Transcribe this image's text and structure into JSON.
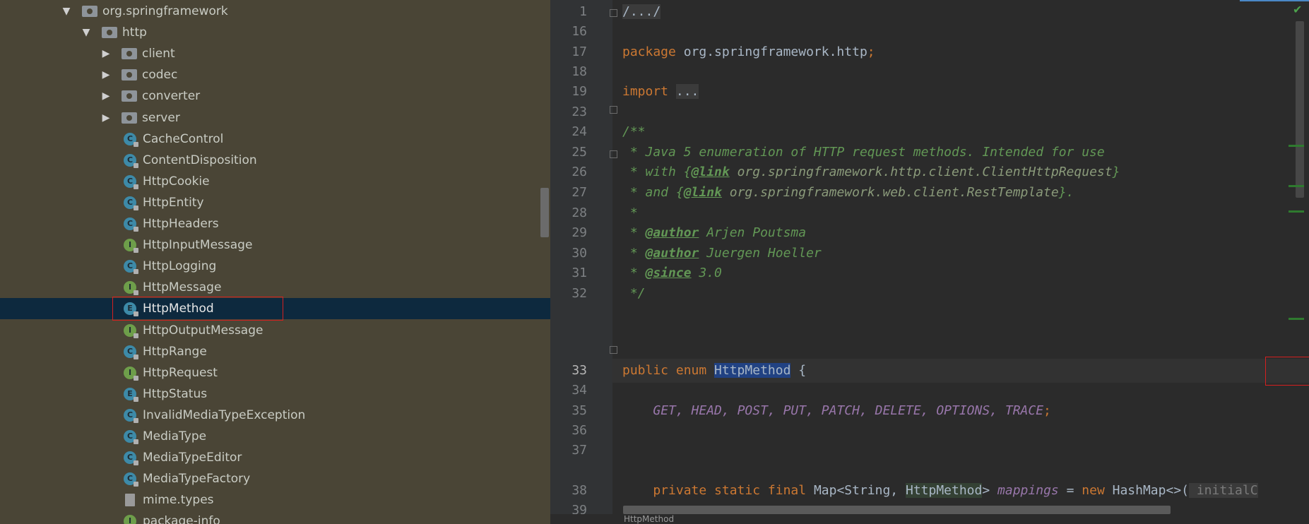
{
  "project_tree": {
    "rows": [
      {
        "label": "org.springframework",
        "kind": "package",
        "arrow": "▼",
        "indent": 0
      },
      {
        "label": "http",
        "kind": "package",
        "arrow": "▼",
        "indent": 1
      },
      {
        "label": "client",
        "kind": "package",
        "arrow": "▶",
        "indent": 2
      },
      {
        "label": "codec",
        "kind": "package",
        "arrow": "▶",
        "indent": 2
      },
      {
        "label": "converter",
        "kind": "package",
        "arrow": "▶",
        "indent": 2
      },
      {
        "label": "server",
        "kind": "package",
        "arrow": "▶",
        "indent": 2
      },
      {
        "label": "CacheControl",
        "kind": "class",
        "badge": "C",
        "indent": 3
      },
      {
        "label": "ContentDisposition",
        "kind": "class",
        "badge": "C",
        "indent": 3
      },
      {
        "label": "HttpCookie",
        "kind": "class",
        "badge": "C",
        "indent": 3
      },
      {
        "label": "HttpEntity",
        "kind": "class",
        "badge": "C",
        "indent": 3
      },
      {
        "label": "HttpHeaders",
        "kind": "class",
        "badge": "C",
        "indent": 3
      },
      {
        "label": "HttpInputMessage",
        "kind": "interface",
        "badge": "I",
        "indent": 3
      },
      {
        "label": "HttpLogging",
        "kind": "class",
        "badge": "C",
        "indent": 3
      },
      {
        "label": "HttpMessage",
        "kind": "interface",
        "badge": "I",
        "indent": 3
      },
      {
        "label": "HttpMethod",
        "kind": "enum",
        "badge": "E",
        "indent": 3,
        "selected": true
      },
      {
        "label": "HttpOutputMessage",
        "kind": "interface",
        "badge": "I",
        "indent": 3
      },
      {
        "label": "HttpRange",
        "kind": "class",
        "badge": "C",
        "indent": 3
      },
      {
        "label": "HttpRequest",
        "kind": "interface",
        "badge": "I",
        "indent": 3
      },
      {
        "label": "HttpStatus",
        "kind": "enum",
        "badge": "E",
        "indent": 3
      },
      {
        "label": "InvalidMediaTypeException",
        "kind": "class",
        "badge": "C",
        "indent": 3
      },
      {
        "label": "MediaType",
        "kind": "class",
        "badge": "C",
        "indent": 3
      },
      {
        "label": "MediaTypeEditor",
        "kind": "class",
        "badge": "C",
        "indent": 3
      },
      {
        "label": "MediaTypeFactory",
        "kind": "class",
        "badge": "C",
        "indent": 3
      },
      {
        "label": "mime.types",
        "kind": "file",
        "indent": 3
      },
      {
        "label": "package-info",
        "kind": "interface",
        "badge": "I",
        "indent": 3
      }
    ]
  },
  "editor": {
    "line_numbers": [
      "1",
      "16",
      "17",
      "18",
      "19",
      "23",
      "24",
      "25",
      "26",
      "27",
      "28",
      "29",
      "30",
      "31",
      "32",
      "33",
      "34",
      "35",
      "36",
      "37",
      "38",
      "39"
    ],
    "current_line": "33",
    "code": {
      "l1": "/.../",
      "l17_kw": "package",
      "l17_rest": " org.springframework.http",
      "l17_semi": ";",
      "l19_kw": "import",
      "l19_fold": "...",
      "l24": "/**",
      "l25": " * Java 5 enumeration of HTTP request methods. Intended for use",
      "l26_a": " * with {",
      "l26_tag": "@link",
      "l26_link": " org.springframework.http.client.ClientHttpRequest",
      "l26_b": "}",
      "l27_a": " * and {",
      "l27_tag": "@link",
      "l27_link": " org.springframework.web.client.RestTemplate",
      "l27_b": "}.",
      "l28": " *",
      "l29_a": " * ",
      "l29_tag": "@author",
      "l29_b": " Arjen Poutsma",
      "l30_a": " * ",
      "l30_tag": "@author",
      "l30_b": " Juergen Hoeller",
      "l31_a": " * ",
      "l31_tag": "@since",
      "l31_b": " 3.0",
      "l32": " */",
      "l33_kw": "public enum ",
      "l33_name": "HttpMethod",
      "l33_rest": " {",
      "l35_indent": "    ",
      "l35_consts": "GET, HEAD, POST, PUT, PATCH, DELETE, OPTIONS, TRACE",
      "l35_semi": ";",
      "l38_kw": "    private static final ",
      "l38_a": "Map<String, ",
      "l38_cls": "HttpMethod",
      "l38_b": "> ",
      "l38_fld": "mappings",
      "l38_c": " = ",
      "l38_new": "new ",
      "l38_d": "HashMap<>(",
      "l38_hint": " initialC"
    }
  },
  "status": {
    "breadcrumb": "HttpMethod"
  },
  "colors": {
    "tree_bg": "#4a4536",
    "selection": "#0d293e",
    "editor_bg": "#2b2b2b",
    "highlight_box": "#d42020"
  }
}
